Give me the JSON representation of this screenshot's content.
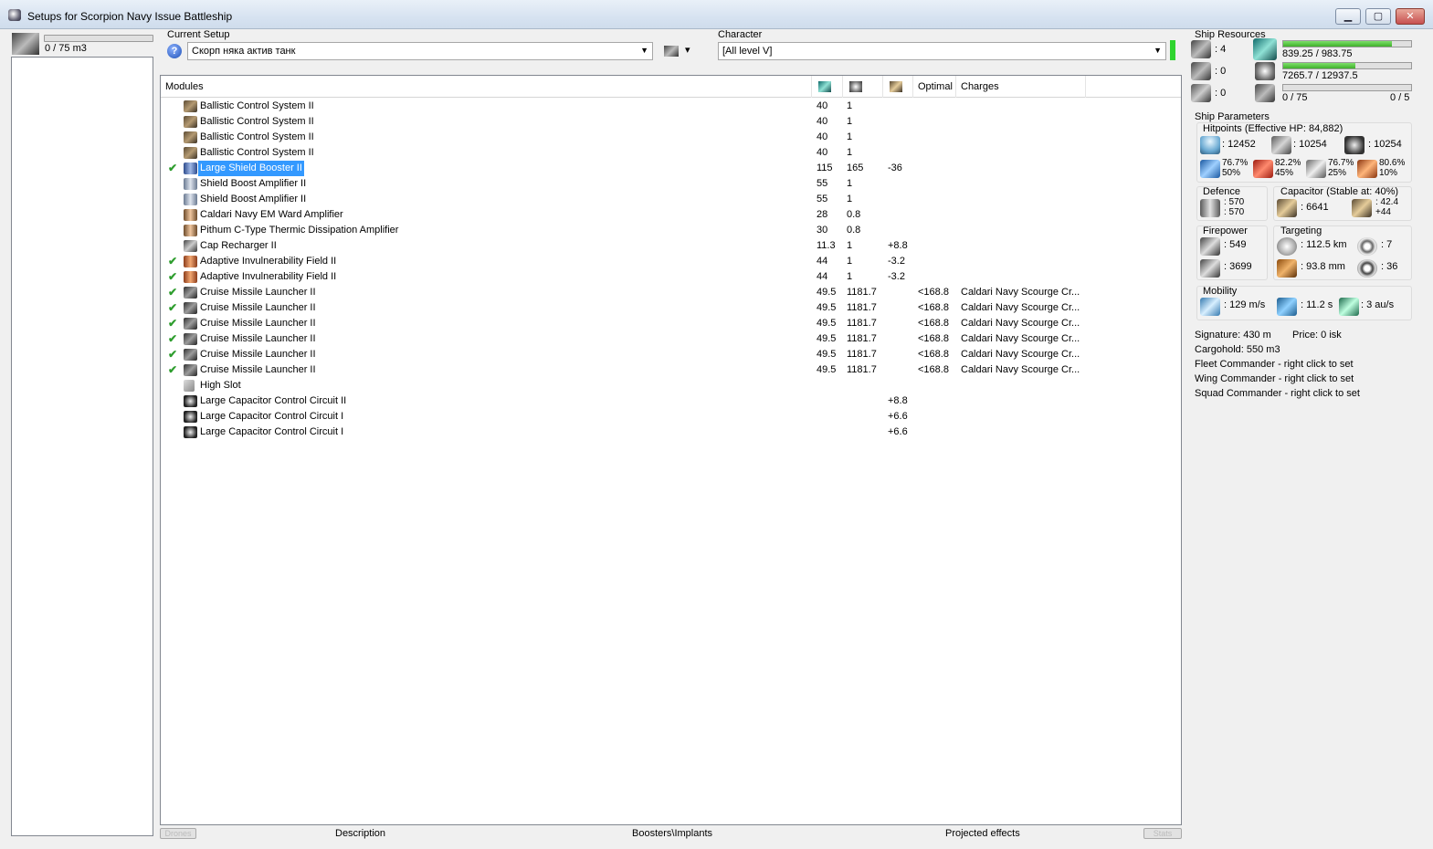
{
  "window": {
    "title": "Setups for Scorpion Navy Issue Battleship",
    "controls": {
      "minimize": "▁",
      "maximize": "▢",
      "close": "✕"
    }
  },
  "drones": {
    "bandwidth_text": "0 / 75 m3",
    "bandwidth_fraction": 0.0,
    "bay_fill_fraction": 1.0
  },
  "setup": {
    "label": "Current Setup",
    "value": "Скорп няка актив танк",
    "help_icon": "?",
    "fit_menu_arrow": "▾"
  },
  "character": {
    "label": "Character",
    "value": "[All level V]",
    "status_color": "#2fd42f"
  },
  "modules": {
    "headers": {
      "name": "Modules",
      "optimal": "Optimal",
      "charges": "Charges"
    },
    "rows": [
      {
        "checked": false,
        "icon": "ballistic-control-icon",
        "name": "Ballistic Control System II",
        "cpu": "40",
        "pg": "1",
        "cap": "",
        "optimal": "",
        "charges": ""
      },
      {
        "checked": false,
        "icon": "ballistic-control-icon",
        "name": "Ballistic Control System II",
        "cpu": "40",
        "pg": "1",
        "cap": "",
        "optimal": "",
        "charges": ""
      },
      {
        "checked": false,
        "icon": "ballistic-control-icon",
        "name": "Ballistic Control System II",
        "cpu": "40",
        "pg": "1",
        "cap": "",
        "optimal": "",
        "charges": ""
      },
      {
        "checked": false,
        "icon": "ballistic-control-icon",
        "name": "Ballistic Control System II",
        "cpu": "40",
        "pg": "1",
        "cap": "",
        "optimal": "",
        "charges": ""
      },
      {
        "checked": true,
        "selected": true,
        "icon": "shield-booster-icon",
        "name": "Large Shield Booster II",
        "cpu": "115",
        "pg": "165",
        "cap": "-36",
        "optimal": "",
        "charges": ""
      },
      {
        "checked": false,
        "icon": "shield-boost-amplifier-icon",
        "name": "Shield Boost Amplifier II",
        "cpu": "55",
        "pg": "1",
        "cap": "",
        "optimal": "",
        "charges": ""
      },
      {
        "checked": false,
        "icon": "shield-boost-amplifier-icon",
        "name": "Shield Boost Amplifier II",
        "cpu": "55",
        "pg": "1",
        "cap": "",
        "optimal": "",
        "charges": ""
      },
      {
        "checked": false,
        "icon": "ward-amplifier-icon",
        "name": "Caldari Navy EM Ward Amplifier",
        "cpu": "28",
        "pg": "0.8",
        "cap": "",
        "optimal": "",
        "charges": ""
      },
      {
        "checked": false,
        "icon": "ward-amplifier-icon",
        "name": "Pithum C-Type Thermic Dissipation Amplifier",
        "cpu": "30",
        "pg": "0.8",
        "cap": "",
        "optimal": "",
        "charges": ""
      },
      {
        "checked": false,
        "icon": "cap-recharger-icon",
        "name": "Cap Recharger II",
        "cpu": "11.3",
        "pg": "1",
        "cap": "+8.8",
        "optimal": "",
        "charges": ""
      },
      {
        "checked": true,
        "icon": "invulnerability-field-icon",
        "name": "Adaptive Invulnerability Field II",
        "cpu": "44",
        "pg": "1",
        "cap": "-3.2",
        "optimal": "",
        "charges": ""
      },
      {
        "checked": true,
        "icon": "invulnerability-field-icon",
        "name": "Adaptive Invulnerability Field II",
        "cpu": "44",
        "pg": "1",
        "cap": "-3.2",
        "optimal": "",
        "charges": ""
      },
      {
        "checked": true,
        "icon": "missile-launcher-icon",
        "name": "Cruise Missile Launcher II",
        "cpu": "49.5",
        "pg": "1181.7",
        "cap": "",
        "optimal": "<168.8",
        "charges": "Caldari Navy Scourge Cr..."
      },
      {
        "checked": true,
        "icon": "missile-launcher-icon",
        "name": "Cruise Missile Launcher II",
        "cpu": "49.5",
        "pg": "1181.7",
        "cap": "",
        "optimal": "<168.8",
        "charges": "Caldari Navy Scourge Cr..."
      },
      {
        "checked": true,
        "icon": "missile-launcher-icon",
        "name": "Cruise Missile Launcher II",
        "cpu": "49.5",
        "pg": "1181.7",
        "cap": "",
        "optimal": "<168.8",
        "charges": "Caldari Navy Scourge Cr..."
      },
      {
        "checked": true,
        "icon": "missile-launcher-icon",
        "name": "Cruise Missile Launcher II",
        "cpu": "49.5",
        "pg": "1181.7",
        "cap": "",
        "optimal": "<168.8",
        "charges": "Caldari Navy Scourge Cr..."
      },
      {
        "checked": true,
        "icon": "missile-launcher-icon",
        "name": "Cruise Missile Launcher II",
        "cpu": "49.5",
        "pg": "1181.7",
        "cap": "",
        "optimal": "<168.8",
        "charges": "Caldari Navy Scourge Cr..."
      },
      {
        "checked": true,
        "icon": "missile-launcher-icon",
        "name": "Cruise Missile Launcher II",
        "cpu": "49.5",
        "pg": "1181.7",
        "cap": "",
        "optimal": "<168.8",
        "charges": "Caldari Navy Scourge Cr..."
      },
      {
        "checked": false,
        "icon": "high-slot-icon",
        "name": "High Slot",
        "cpu": "",
        "pg": "",
        "cap": "",
        "optimal": "",
        "charges": ""
      },
      {
        "checked": false,
        "icon": "capacitor-control-circuit-icon",
        "name": "Large Capacitor Control Circuit II",
        "cpu": "",
        "pg": "",
        "cap": "+8.8",
        "optimal": "",
        "charges": ""
      },
      {
        "checked": false,
        "icon": "capacitor-control-circuit-icon",
        "name": "Large Capacitor Control Circuit I",
        "cpu": "",
        "pg": "",
        "cap": "+6.6",
        "optimal": "",
        "charges": ""
      },
      {
        "checked": false,
        "icon": "capacitor-control-circuit-icon",
        "name": "Large Capacitor Control Circuit I",
        "cpu": "",
        "pg": "",
        "cap": "+6.6",
        "optimal": "",
        "charges": ""
      }
    ]
  },
  "bottom_tabs": {
    "drones": "Drones",
    "description": "Description",
    "boosters": "Boosters\\Implants",
    "projected": "Projected effects",
    "stats": "Stats"
  },
  "ship_resources": {
    "title": "Ship Resources",
    "turret_hardpoints": ": 4",
    "launcher_hardpoints": ": 0",
    "calibration": ": 0",
    "cpu_text": "839.25 / 983.75",
    "cpu_fraction": 0.853,
    "powergrid_text": "7265.7 / 12937.5",
    "powergrid_fraction": 0.562,
    "calibration_text": "0 / 75",
    "calibration_fraction": 0.0,
    "drones_text": "0 / 5"
  },
  "ship_parameters": {
    "title": "Ship Parameters",
    "hitpoints": {
      "label": "Hitpoints (Effective HP: 84,882)",
      "shield": ": 12452",
      "armor": ": 10254",
      "hull": ": 10254",
      "res_em": "76.7%\n50%",
      "res_thermal": "82.2%\n45%",
      "res_kinetic": "76.7%\n25%",
      "res_explosive": "80.6%\n10%"
    },
    "defence": {
      "label": "Defence",
      "value": ": 570\n: 570"
    },
    "capacitor": {
      "label": "Capacitor (Stable at: 40%)",
      "capacity": ": 6641",
      "delta": ": 42.4\n+44"
    },
    "firepower": {
      "label": "Firepower",
      "dps": ": 549",
      "volley": ": 3699"
    },
    "targeting": {
      "label": "Targeting",
      "range": ": 112.5 km",
      "max_targets": ": 7",
      "scan_res": ": 93.8 mm",
      "sensor": ": 36"
    },
    "mobility": {
      "label": "Mobility",
      "speed": ": 129 m/s",
      "align": ": 11.2 s",
      "warp": ": 3 au/s"
    },
    "signature": "Signature: 430 m",
    "price": "Price: 0 isk",
    "cargohold": "Cargohold: 550 m3",
    "fleet_commander": "Fleet Commander - right click to set",
    "wing_commander": "Wing Commander - right click to set",
    "squad_commander": "Squad Commander - right click to set"
  }
}
